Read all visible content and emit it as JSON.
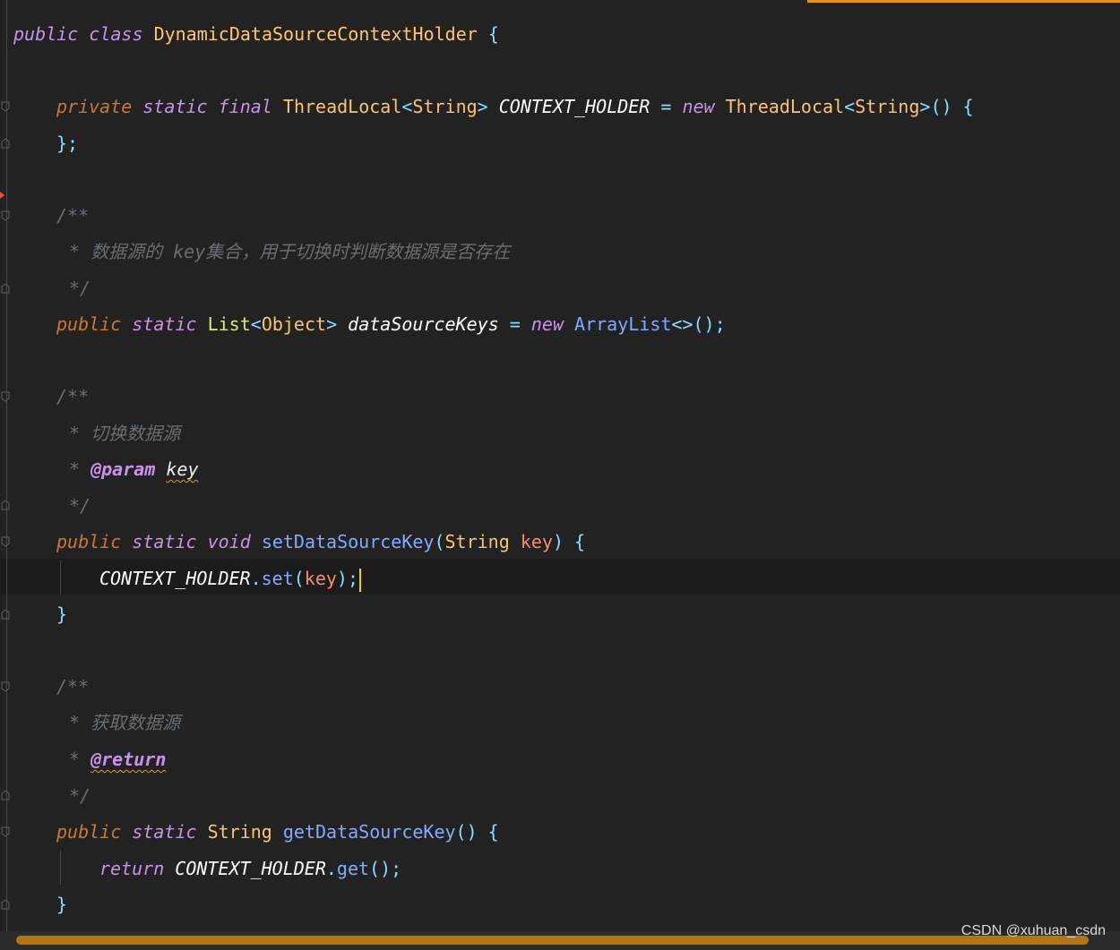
{
  "colors": {
    "background": "#222223",
    "current_line": "#1b1b1c",
    "accent": "#e8900c",
    "keyword": "#c792ea",
    "comment": "#676e74"
  },
  "code": {
    "class_decl": {
      "public": "public",
      "class": "class",
      "name": "DynamicDataSourceContextHolder",
      "brace": "{"
    },
    "field_holder": {
      "private": "private",
      "static": "static",
      "final": "final",
      "type": "ThreadLocal",
      "lt": "<",
      "generic": "String",
      "gt": ">",
      "name": "CONTEXT_HOLDER",
      "eq": "=",
      "new": "new",
      "ctor": "ThreadLocal",
      "ctor_generic": "String",
      "ctor_tail": "() {"
    },
    "field_holder_close": "};",
    "doc1": {
      "open": "/**",
      "star": "*",
      "text_a": "数据源的",
      "text_key": "key",
      "text_b": "集合，用于切换时判断数据源是否存在",
      "close": "*/"
    },
    "field_keys": {
      "public": "public",
      "static": "static",
      "type": "List",
      "lt": "<",
      "generic": "Object",
      "gt": ">",
      "name": "dataSourceKeys",
      "eq": "=",
      "new": "new",
      "ctor": "ArrayList",
      "tail": "<>();"
    },
    "doc2": {
      "open": "/**",
      "star": "*",
      "text": "切换数据源",
      "tag": "@param",
      "tag_value": "key",
      "close": "*/"
    },
    "set_method": {
      "public": "public",
      "static": "static",
      "void": "void",
      "name": "setDataSourceKey",
      "lparen": "(",
      "ptype": "String",
      "pname": "key",
      "rparen": ")",
      "brace": "{"
    },
    "set_body": {
      "target": "CONTEXT_HOLDER",
      "dot": ".",
      "call": "set",
      "lparen": "(",
      "arg": "key",
      "rparen": ");"
    },
    "set_close": "}",
    "doc3": {
      "open": "/**",
      "star": "*",
      "text": "获取数据源",
      "tag": "@return",
      "close": "*/"
    },
    "get_method": {
      "public": "public",
      "static": "static",
      "type": "String",
      "name": "getDataSourceKey",
      "tail": "() {"
    },
    "get_body": {
      "return": "return",
      "target": "CONTEXT_HOLDER",
      "dot": ".",
      "call": "get",
      "tail": "();"
    },
    "get_close": "}"
  },
  "watermark": "CSDN @xuhuan_csdn"
}
